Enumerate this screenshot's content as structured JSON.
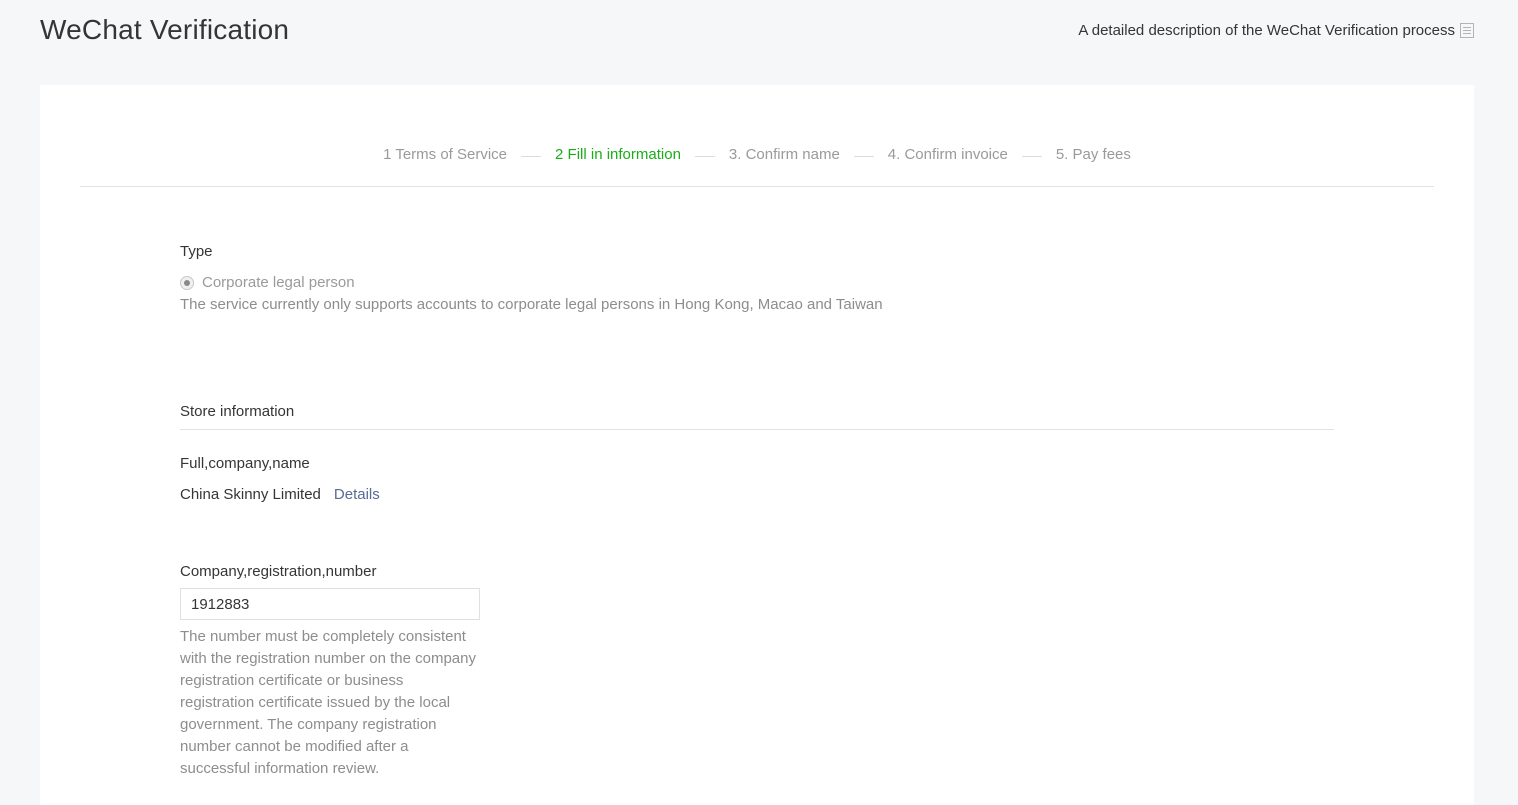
{
  "header": {
    "title": "WeChat Verification",
    "description_link": "A detailed description of the WeChat Verification process",
    "description_icon": "document-icon"
  },
  "steps": [
    {
      "label": "1 Terms of Service",
      "active": false
    },
    {
      "label": "2 Fill in information",
      "active": true
    },
    {
      "label": "3. Confirm name",
      "active": false
    },
    {
      "label": "4. Confirm invoice",
      "active": false
    },
    {
      "label": "5. Pay fees",
      "active": false
    }
  ],
  "type_section": {
    "label": "Type",
    "option": "Corporate legal person",
    "option_selected": true,
    "tip": "The service currently only supports accounts to corporate legal persons in Hong Kong, Macao and Taiwan"
  },
  "store_section": {
    "title": "Store information",
    "company_name_label": "Full,company,name",
    "company_name_value": "China Skinny Limited",
    "details_link": "Details",
    "registration_label": "Company,registration,number",
    "registration_value": "1912883",
    "registration_tip": "The number must be completely consistent with the registration number on the company registration certificate or business registration certificate issued by the local government. The company registration number cannot be modified after a successful information review."
  },
  "colors": {
    "background": "#f6f7f9",
    "card": "#ffffff",
    "active_step": "#1aad19",
    "link": "#576b95",
    "muted_text": "#8d8d8d"
  }
}
